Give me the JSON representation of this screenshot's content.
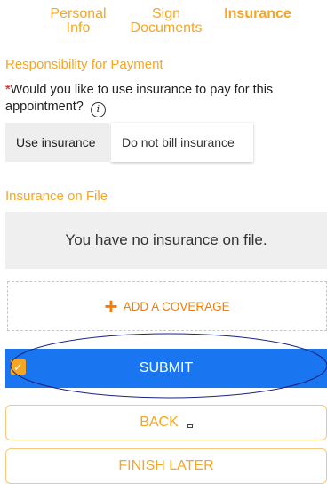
{
  "steps": [
    {
      "line1": "Personal",
      "line2": "Info"
    },
    {
      "line1": "Sign",
      "line2": "Documents"
    },
    {
      "line1": "Insurance",
      "line2": ""
    }
  ],
  "responsibility": {
    "title": "Responsibility for Payment",
    "required_mark": "*",
    "question": "Would you like to use insurance to pay for this appointment?",
    "info_icon": "i",
    "options": [
      "Use insurance",
      "Do not bill insurance"
    ]
  },
  "insurance_on_file": {
    "title": "Insurance on File",
    "empty_message": "You have no insurance on file."
  },
  "add_coverage": {
    "plus": "+",
    "label": "ADD A COVERAGE"
  },
  "submit": {
    "label": "SUBMIT",
    "checkbox_mark": "✓"
  },
  "back": {
    "label": "BACK"
  },
  "finish_later": {
    "label": "FINISH LATER"
  }
}
